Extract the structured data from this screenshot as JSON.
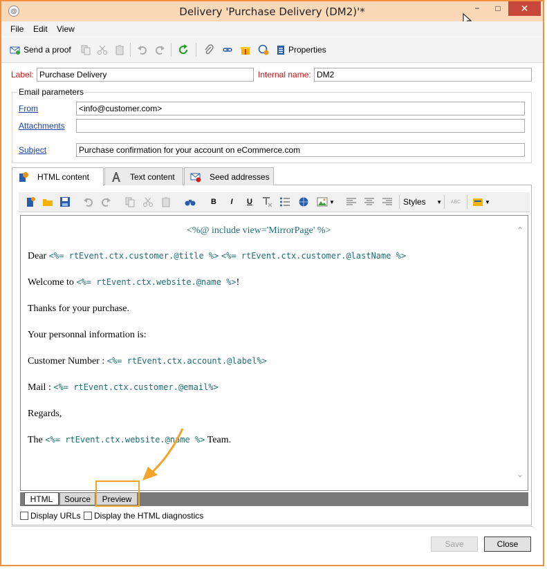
{
  "window": {
    "title": "Delivery 'Purchase Delivery (DM2)'*",
    "minimize_glyph": "−",
    "maximize_glyph": "□",
    "close_glyph": "✕"
  },
  "menu": {
    "file": "File",
    "edit": "Edit",
    "view": "View"
  },
  "toolbar": {
    "send_proof": "Send a proof",
    "properties": "Properties"
  },
  "form": {
    "label_caption": "Label:",
    "label_value": "Purchase Delivery",
    "internal_name_caption": "Internal name:",
    "internal_name_value": "DM2"
  },
  "email_params": {
    "group_title": "Email parameters",
    "from_link": "From",
    "from_value": "<info@customer.com>",
    "attachments_link": "Attachments",
    "attachments_value": "",
    "subject_link": "Subject",
    "subject_value": "Purchase confirmation for your account on eCommerce.com"
  },
  "tabs": [
    {
      "label": "HTML content"
    },
    {
      "label": "Text content"
    },
    {
      "label": "Seed addresses"
    }
  ],
  "editor_toolbar": {
    "bold": "B",
    "italic": "I",
    "underline": "U",
    "styles_label": "Styles",
    "spell_label": "ABC"
  },
  "editor": {
    "include_line": "<%@ include view='MirrorPage' %>",
    "dear_text": "Dear",
    "dear_tag1": "<%= rtEvent.ctx.customer.@title %>",
    "dear_tag2": "<%= rtEvent.ctx.customer.@lastName %>",
    "welcome_text": "Welcome to",
    "welcome_tag": "<%= rtEvent.ctx.website.@name %>",
    "welcome_end": "!",
    "thanks": "Thanks for your purchase.",
    "personal_info": "Your personnal information is:",
    "customer_number_text": "Customer Number :",
    "customer_number_tag": "<%= rtEvent.ctx.account.@label%>",
    "mail_text": "Mail :",
    "mail_tag": "<%= rtEvent.ctx.customer.@email%>",
    "regards": "Regards,",
    "the_text": "The",
    "team_tag": "<%= rtEvent.ctx.website.@name %>",
    "team_text": "Team."
  },
  "editor_tabs": [
    "HTML",
    "Source",
    "Preview"
  ],
  "options": {
    "display_urls": "Display URLs",
    "html_diagnostics": "Display the HTML diagnostics"
  },
  "buttons": {
    "save": "Save",
    "close": "Close"
  },
  "colors": {
    "accent": "#ef8f3f",
    "highlight": "#f3a32a",
    "tag": "#1e6e73",
    "required_label": "#cc1111"
  }
}
